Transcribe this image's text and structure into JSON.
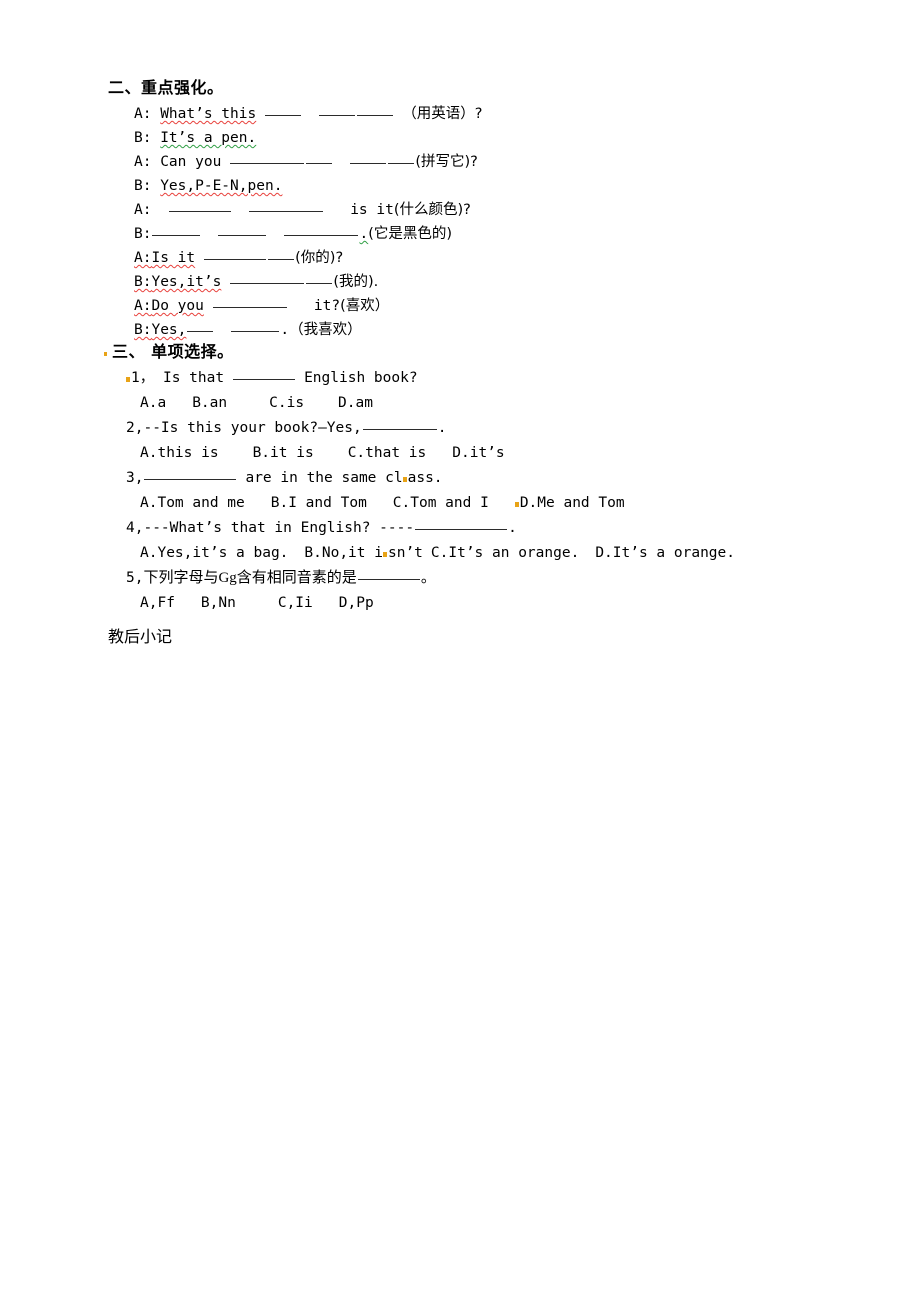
{
  "section2": {
    "heading": "二、重点强化。",
    "dialogue": [
      {
        "speaker": "A:",
        "pre": "What’s this",
        "note": "（用英语）?"
      },
      {
        "speaker": "B:",
        "pre": "It’s a pen.",
        "note": ""
      },
      {
        "speaker": "A:",
        "pre": "Can you",
        "note": "(拼写它)?"
      },
      {
        "speaker": "B:",
        "pre": "Yes,P-E-N,pen.",
        "note": ""
      },
      {
        "speaker": "A:",
        "pre": "",
        "mid": "is  it",
        "note": "(什么颜色)?"
      },
      {
        "speaker": "B:",
        "pre": "",
        "note": "(它是黑色的)"
      },
      {
        "speaker": "A:",
        "pre": "Is it",
        "note": "(你的)?"
      },
      {
        "speaker": "B:",
        "pre": "Yes,it’s",
        "note": "(我的)."
      },
      {
        "speaker": "A:",
        "pre": "Do you",
        "mid": "it?",
        "note": "(喜欢）"
      },
      {
        "speaker": "B:",
        "pre": "Yes,",
        "note": "（我喜欢）"
      }
    ]
  },
  "section3": {
    "heading": "三、 单项选择。",
    "questions": [
      {
        "number": "1，",
        "stem_before": "Is that",
        "stem_after": "English book?",
        "options": [
          "A.a",
          "B.an",
          "C.is",
          "D.am"
        ]
      },
      {
        "number": "2,",
        "stem_before": "--Is this your book?—Yes,",
        "stem_after": ".",
        "options": [
          "A.this is",
          "B.it is",
          "C.that is",
          "D.it’s"
        ]
      },
      {
        "number": "3,",
        "stem_before": "",
        "stem_after": "are in the same class.",
        "options": [
          "A.Tom and me",
          "B.I and Tom",
          "C.Tom and I",
          "D.Me and Tom"
        ]
      },
      {
        "number": "4,",
        "stem_before": "---What’s that in English?  ----",
        "stem_after": ".",
        "options": [
          "A.Yes,it’s a bag.",
          "B.No,it isn’t",
          "C.It’s an orange.",
          "D.It’s a orange."
        ]
      },
      {
        "number": "5,",
        "stem_before": "下列字母与Gg含有相同音素的是",
        "stem_after": "。",
        "options": [
          "A,Ff",
          "B,Nn",
          "C,Ii",
          "D,Pp"
        ]
      }
    ]
  },
  "footer": {
    "note": "教后小记"
  },
  "colors": {
    "spell_error": "#e8413c",
    "grammar_error": "#2f9e44",
    "comment_anchor": "#e8a317",
    "text": "#000000",
    "background": "#ffffff"
  }
}
